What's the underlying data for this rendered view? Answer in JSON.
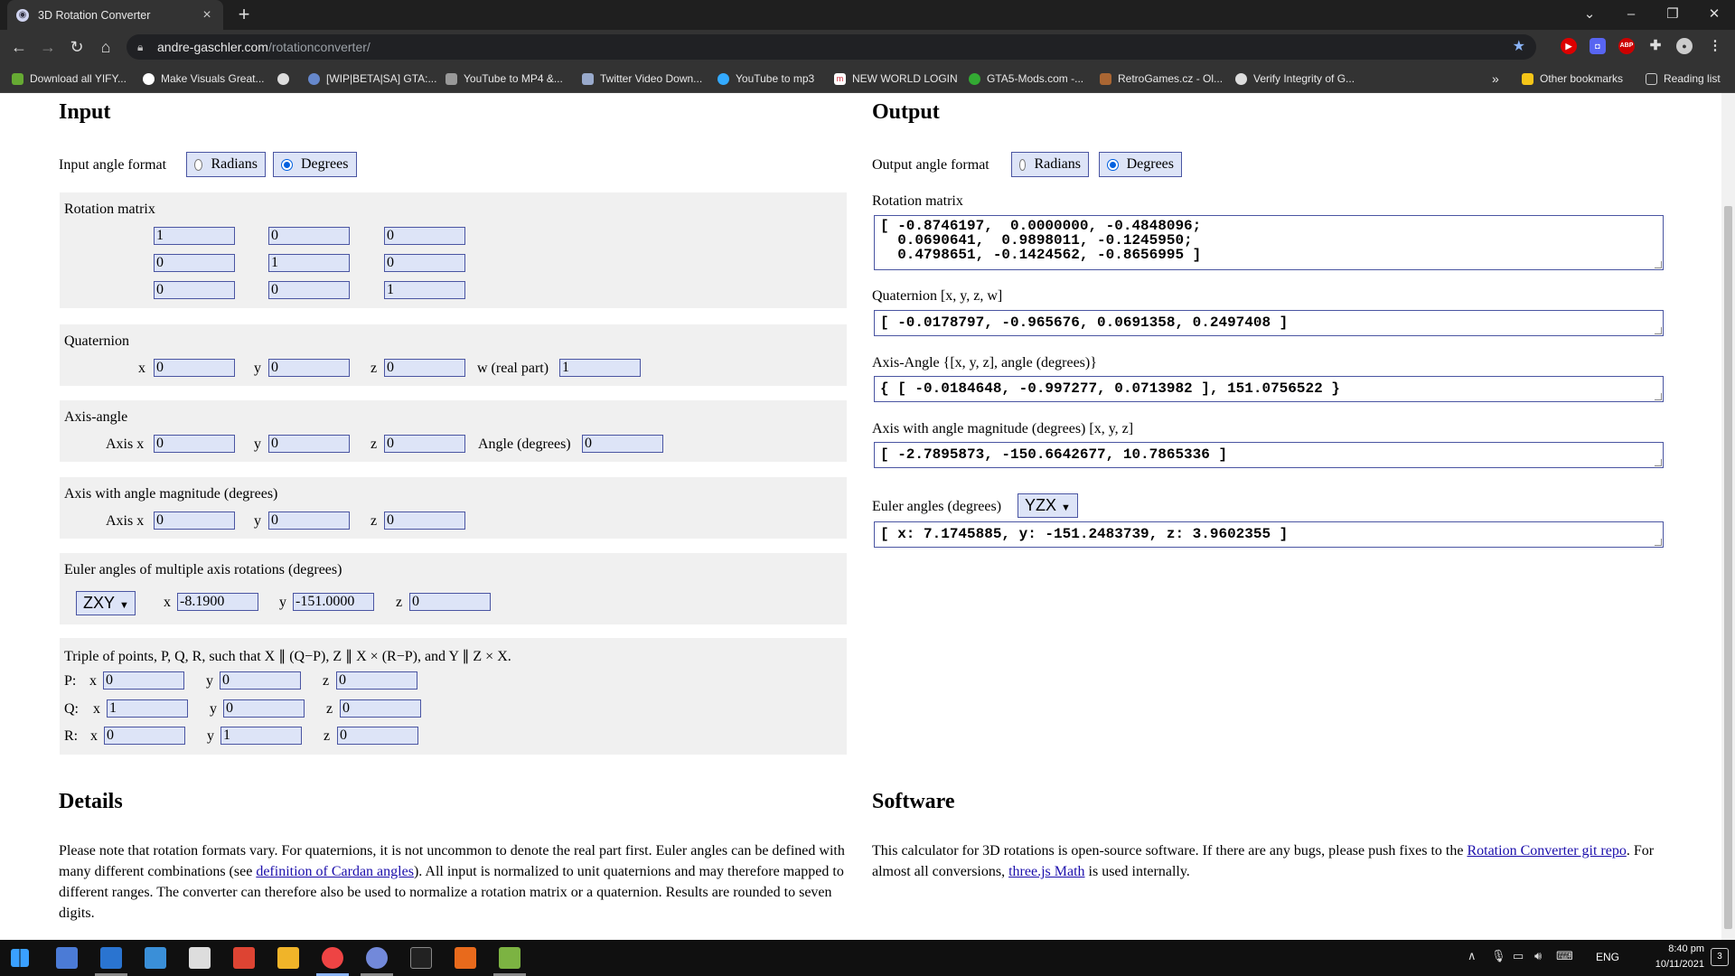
{
  "browser": {
    "tab_title": "3D Rotation Converter",
    "url_domain": "andre-gaschler.com",
    "url_path": "/rotationconverter/",
    "bookmarks": [
      "Download all YIFY...",
      "Make Visuals Great...",
      "[WIP|BETA|SA] GTA:...",
      "YouTube to MP4 &...",
      "Twitter Video Down...",
      "YouTube to mp3",
      "NEW WORLD LOGIN",
      "GTA5-Mods.com -...",
      "RetroGames.cz - Ol...",
      "Verify Integrity of G..."
    ],
    "overflow": "»",
    "other_bookmarks": "Other bookmarks",
    "reading_list": "Reading list"
  },
  "input": {
    "heading": "Input",
    "angle_format_label": "Input angle format",
    "radians_label": "Radians",
    "degrees_label": "Degrees",
    "selected_format": "Degrees",
    "rotation_matrix": {
      "label": "Rotation matrix",
      "rows": [
        [
          "1",
          "0",
          "0"
        ],
        [
          "0",
          "1",
          "0"
        ],
        [
          "0",
          "0",
          "1"
        ]
      ]
    },
    "quaternion": {
      "label": "Quaternion",
      "x_label": "x",
      "y_label": "y",
      "z_label": "z",
      "w_label": "w (real part)",
      "x": "0",
      "y": "0",
      "z": "0",
      "w": "1"
    },
    "axis_angle": {
      "label": "Axis-angle",
      "x_label": "Axis x",
      "y_label": "y",
      "z_label": "z",
      "angle_label": "Angle (degrees)",
      "x": "0",
      "y": "0",
      "z": "0",
      "angle": "0"
    },
    "axis_magnitude": {
      "label": "Axis with angle magnitude (degrees)",
      "x_label": "Axis x",
      "y_label": "y",
      "z_label": "z",
      "x": "0",
      "y": "0",
      "z": "0"
    },
    "euler": {
      "label": "Euler angles of multiple axis rotations (degrees)",
      "order": "ZXY",
      "x_label": "x",
      "y_label": "y",
      "z_label": "z",
      "x": "-8.1900",
      "y": "-151.0000",
      "z": "0"
    },
    "points": {
      "label": "Triple of points, P, Q, R, such that X ∥ (Q−P),   Z ∥ X × (R−P),  and Y ∥ Z × X.",
      "rows": [
        {
          "name": "P:",
          "x": "0",
          "y": "0",
          "z": "0"
        },
        {
          "name": "Q:",
          "x": "1",
          "y": "0",
          "z": "0"
        },
        {
          "name": "R:",
          "x": "0",
          "y": "1",
          "z": "0"
        }
      ],
      "x_label": "x",
      "y_label": "y",
      "z_label": "z"
    }
  },
  "output": {
    "heading": "Output",
    "angle_format_label": "Output angle format",
    "radians_label": "Radians",
    "degrees_label": "Degrees",
    "selected_format": "Degrees",
    "rotation_matrix_label": "Rotation matrix",
    "rotation_matrix_value": "[ -0.8746197,  0.0000000, -0.4848096;\n  0.0690641,  0.9898011, -0.1245950;\n  0.4798651, -0.1424562, -0.8656995 ]",
    "quaternion_label": "Quaternion [x, y, z, w]",
    "quaternion_value": "[ -0.0178797, -0.965676, 0.0691358, 0.2497408 ]",
    "axis_angle_label": "Axis-Angle {[x, y, z], angle (degrees)}",
    "axis_angle_value": "{ [ -0.0184648, -0.997277, 0.0713982 ], 151.0756522 }",
    "axis_magnitude_label": "Axis with angle magnitude (degrees) [x, y, z]",
    "axis_magnitude_value": "[ -2.7895873, -150.6642677, 10.7865336 ]",
    "euler_label": "Euler angles (degrees)",
    "euler_order": "YZX",
    "euler_value": "[ x: 7.1745885, y: -151.2483739, z: 3.9602355 ]"
  },
  "details": {
    "heading": "Details",
    "text_1": "Please note that rotation formats vary. For quaternions, it is not uncommon to denote the real part first. Euler angles can be defined with many different combinations (see ",
    "link": "definition of Cardan angles",
    "text_2": "). All input is normalized to unit quaternions and may therefore mapped to different ranges. The converter can therefore also be used to normalize a rotation matrix or a quaternion. Results are rounded to seven digits."
  },
  "software": {
    "heading": "Software",
    "text_1": "This calculator for 3D rotations is open-source software. If there are any bugs, please push fixes to the ",
    "link_1": "Rotation Converter git repo",
    "text_2": ". For almost all conversions, ",
    "link_2": "three.js Math",
    "text_3": " is used internally."
  },
  "taskbar": {
    "language": "ENG",
    "time": "8:40 pm",
    "date": "10/11/2021",
    "notifications": "3"
  }
}
